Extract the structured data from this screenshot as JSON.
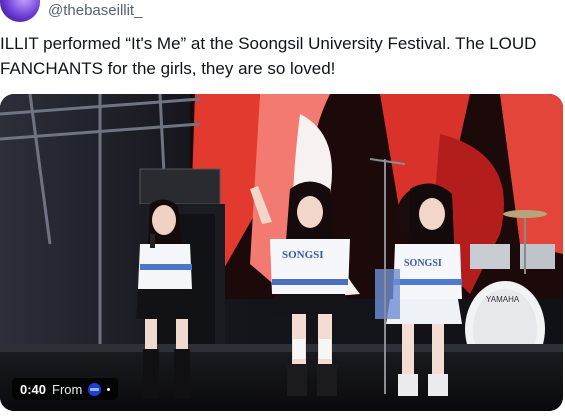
{
  "author": {
    "handle": "@thebaseillit_"
  },
  "tweet": {
    "text": "ILLIT performed “It's Me” at the Soongsil University Festival. The LOUD FANCHANTS for the girls, they are so loved!"
  },
  "video": {
    "timestamp": "0:40",
    "source_prefix": "From",
    "source_icon": "source-logo-icon",
    "jersey_text_center": "SONGSI",
    "jersey_text_right": "SONGSI",
    "drum_brand": "YAMAHA"
  }
}
